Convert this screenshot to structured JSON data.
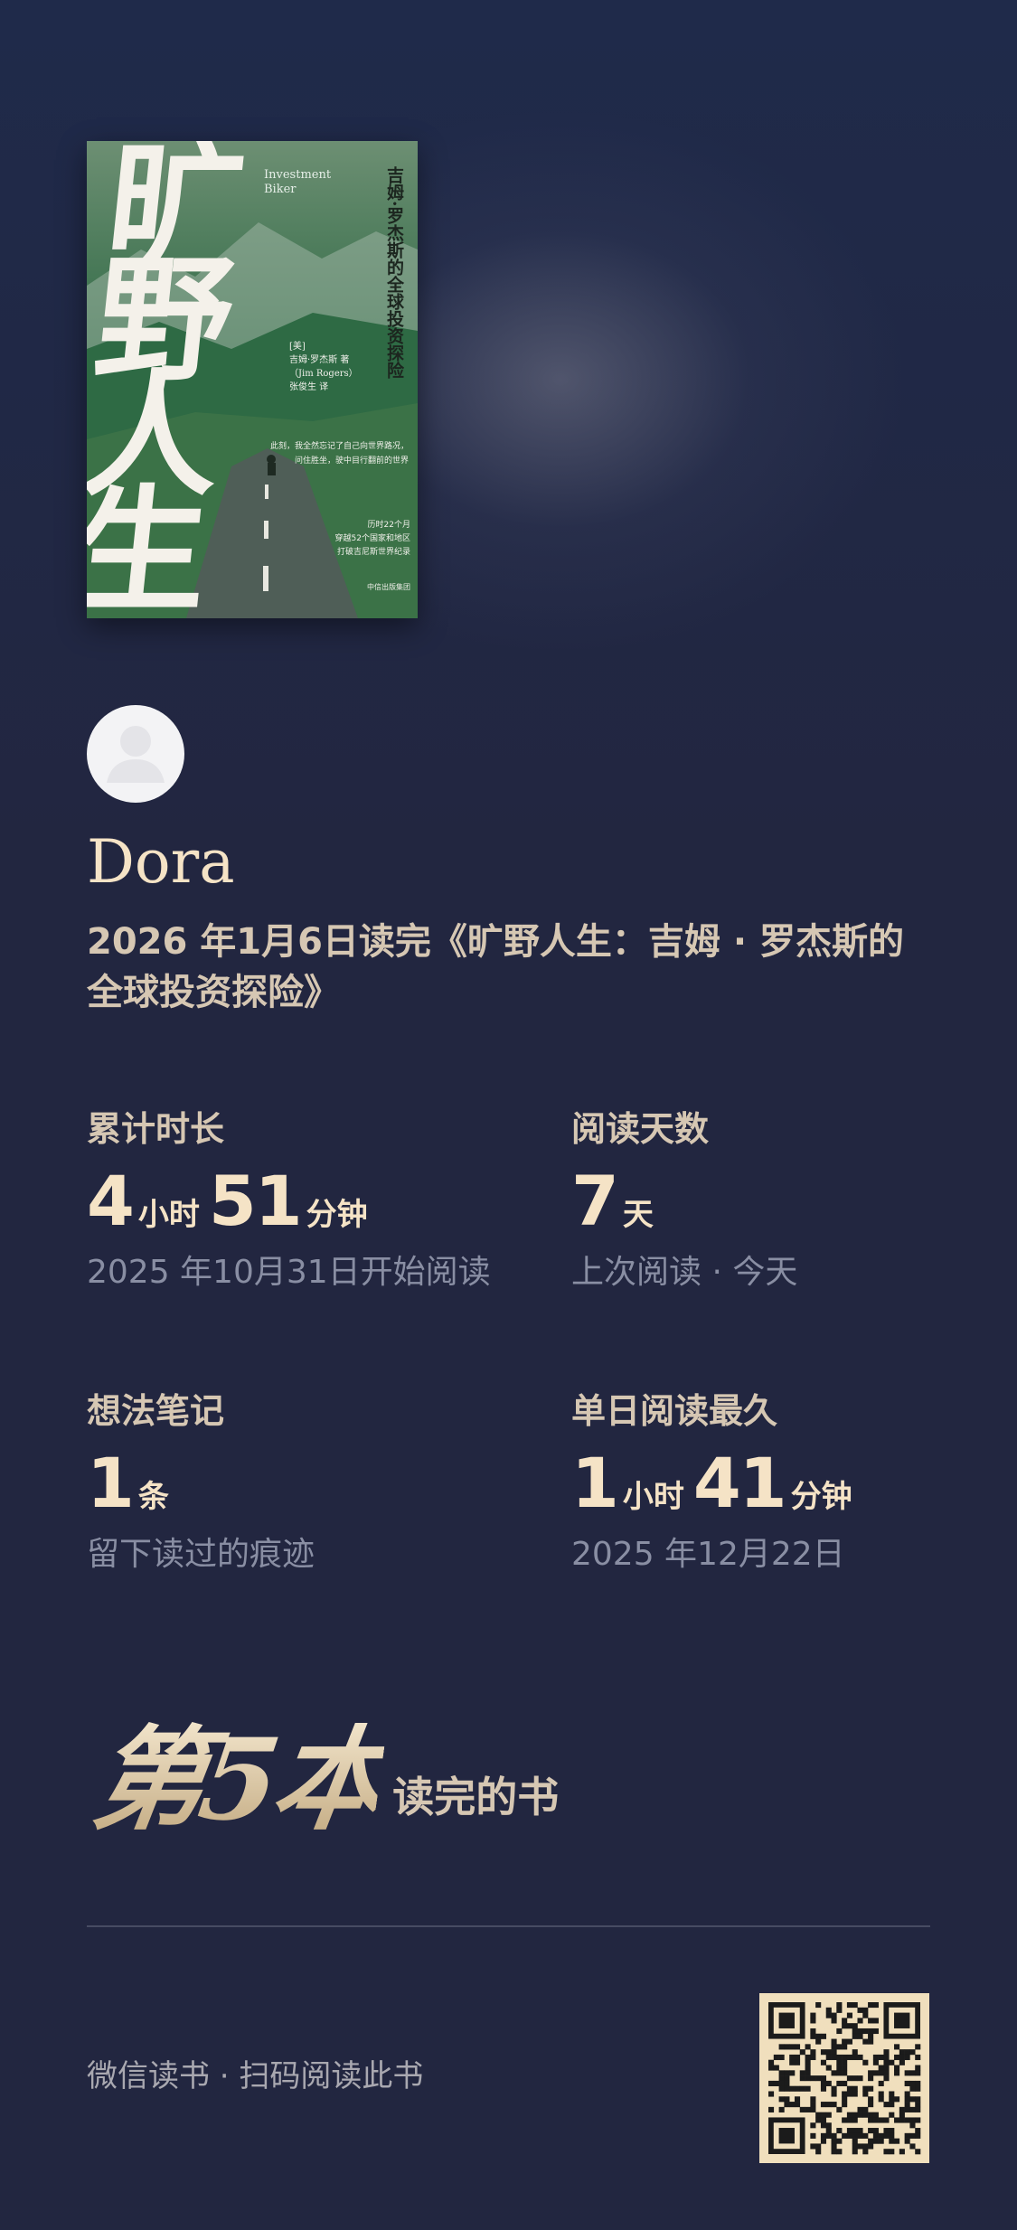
{
  "cover": {
    "title_large": "旷野人生",
    "title_en": "Investment\nBiker",
    "subtitle": "吉姆·罗杰斯的全球投资探险",
    "author_block": "[美]\n吉姆·罗杰斯 著\n（Jim Rogers）\n张俊生 译",
    "quote": "此刻，我全然忘记了自己向世界路况，\n问住胜坐，驶中目行翻前的世界",
    "stats": "历时22个月\n穿越52个国家和地区\n打破吉尼斯世界纪录",
    "publisher": "中信出版集团"
  },
  "user": {
    "name": "Dora"
  },
  "headline": "2026 年1月6日读完《旷野人生：吉姆 · 罗杰斯的全球投资探险》",
  "stats": [
    {
      "label": "累计时长",
      "num1": "4",
      "unit1": "小时",
      "num2": "51",
      "unit2": "分钟",
      "sub": "2025 年10月31日开始阅读"
    },
    {
      "label": "阅读天数",
      "num1": "7",
      "unit1": "天",
      "sub": "上次阅读 · 今天"
    },
    {
      "label": "想法笔记",
      "num1": "1",
      "unit1": "条",
      "sub": "留下读过的痕迹"
    },
    {
      "label": "单日阅读最久",
      "num1": "1",
      "unit1": "小时",
      "num2": "41",
      "unit2": "分钟",
      "sub": "2025 年12月22日"
    }
  ],
  "rank": {
    "text": "第5本",
    "label": "读完的书"
  },
  "footer": {
    "text": "微信读书 · 扫码阅读此书"
  },
  "colors": {
    "background": "#222640",
    "accent": "#f5e3c6",
    "label": "#d6c7b3",
    "muted": "#898ea3",
    "qr_bg": "#f0dfbd"
  }
}
